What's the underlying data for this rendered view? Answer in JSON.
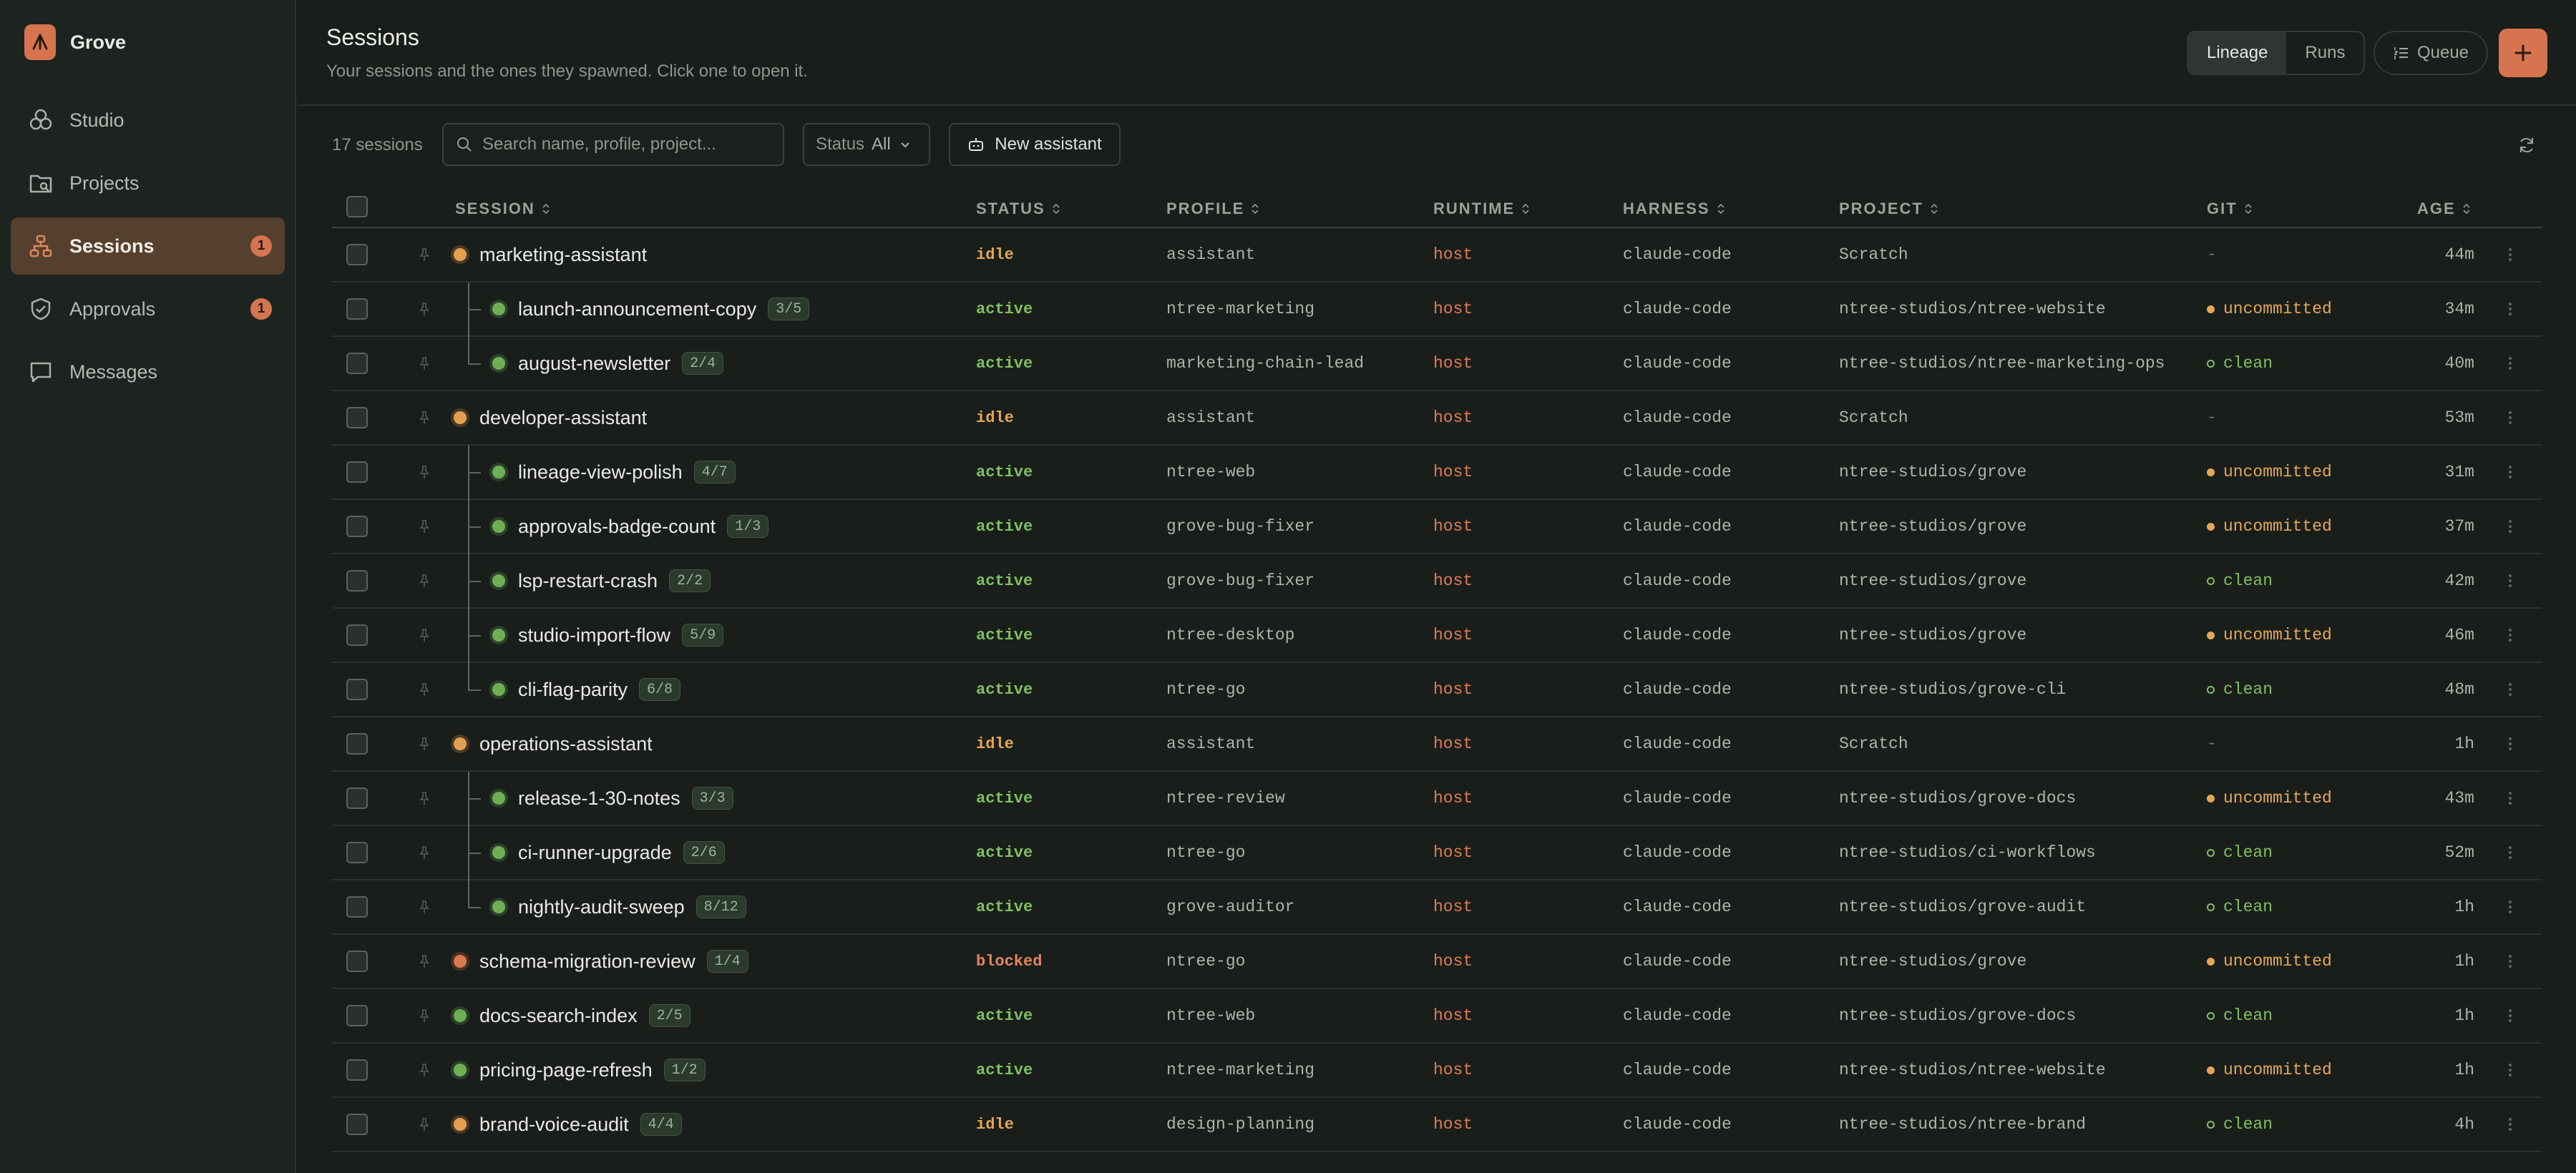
{
  "app": {
    "name": "Grove",
    "accent": "#d5744e"
  },
  "sidebar": {
    "items": [
      {
        "label": "Studio",
        "icon": "studio-icon",
        "badge": null,
        "active": false
      },
      {
        "label": "Projects",
        "icon": "projects-icon",
        "badge": null,
        "active": false
      },
      {
        "label": "Sessions",
        "icon": "sessions-icon",
        "badge": "1",
        "active": true
      },
      {
        "label": "Approvals",
        "icon": "approvals-icon",
        "badge": "1",
        "active": false
      },
      {
        "label": "Messages",
        "icon": "messages-icon",
        "badge": null,
        "active": false
      }
    ]
  },
  "header": {
    "title": "Sessions",
    "subtitle": "Your sessions and the ones they spawned. Click one to open it.",
    "view_tabs": [
      "Lineage",
      "Runs"
    ],
    "active_view": "Lineage",
    "queue_label": "Queue",
    "add_icon": "plus-icon"
  },
  "toolbar": {
    "count_label": "17 sessions",
    "search_placeholder": "Search name, profile, project...",
    "status_label": "Status",
    "status_value": "All",
    "new_assistant_label": "New assistant",
    "refresh_icon": "refresh-icon"
  },
  "table": {
    "columns": [
      "SESSION",
      "STATUS",
      "PROFILE",
      "RUNTIME",
      "HARNESS",
      "PROJECT",
      "GIT",
      "AGE"
    ],
    "rows": [
      {
        "name": "marketing-assistant",
        "progress": "",
        "level": 0,
        "tree": "",
        "dot": "orange",
        "status": "idle",
        "profile": "assistant",
        "runtime": "host",
        "harness": "claude-code",
        "project": "Scratch",
        "git": "-",
        "git_state": "none",
        "age": "44m"
      },
      {
        "name": "launch-announcement-copy",
        "progress": "3/5",
        "level": 1,
        "tree": "mid",
        "dot": "green",
        "status": "active",
        "profile": "ntree-marketing",
        "runtime": "host",
        "harness": "claude-code",
        "project": "ntree-studios/ntree-website",
        "git": "uncommitted",
        "git_state": "uncommitted",
        "age": "34m"
      },
      {
        "name": "august-newsletter",
        "progress": "2/4",
        "level": 1,
        "tree": "last",
        "dot": "green",
        "status": "active",
        "profile": "marketing-chain-lead",
        "runtime": "host",
        "harness": "claude-code",
        "project": "ntree-studios/ntree-marketing-ops",
        "git": "clean",
        "git_state": "clean",
        "age": "40m"
      },
      {
        "name": "developer-assistant",
        "progress": "",
        "level": 0,
        "tree": "",
        "dot": "orange",
        "status": "idle",
        "profile": "assistant",
        "runtime": "host",
        "harness": "claude-code",
        "project": "Scratch",
        "git": "-",
        "git_state": "none",
        "age": "53m"
      },
      {
        "name": "lineage-view-polish",
        "progress": "4/7",
        "level": 1,
        "tree": "mid",
        "dot": "green",
        "status": "active",
        "profile": "ntree-web",
        "runtime": "host",
        "harness": "claude-code",
        "project": "ntree-studios/grove",
        "git": "uncommitted",
        "git_state": "uncommitted",
        "age": "31m"
      },
      {
        "name": "approvals-badge-count",
        "progress": "1/3",
        "level": 1,
        "tree": "mid",
        "dot": "green",
        "status": "active",
        "profile": "grove-bug-fixer",
        "runtime": "host",
        "harness": "claude-code",
        "project": "ntree-studios/grove",
        "git": "uncommitted",
        "git_state": "uncommitted",
        "age": "37m"
      },
      {
        "name": "lsp-restart-crash",
        "progress": "2/2",
        "level": 1,
        "tree": "mid",
        "dot": "green",
        "status": "active",
        "profile": "grove-bug-fixer",
        "runtime": "host",
        "harness": "claude-code",
        "project": "ntree-studios/grove",
        "git": "clean",
        "git_state": "clean",
        "age": "42m"
      },
      {
        "name": "studio-import-flow",
        "progress": "5/9",
        "level": 1,
        "tree": "mid",
        "dot": "green",
        "status": "active",
        "profile": "ntree-desktop",
        "runtime": "host",
        "harness": "claude-code",
        "project": "ntree-studios/grove",
        "git": "uncommitted",
        "git_state": "uncommitted",
        "age": "46m"
      },
      {
        "name": "cli-flag-parity",
        "progress": "6/8",
        "level": 1,
        "tree": "last",
        "dot": "green",
        "status": "active",
        "profile": "ntree-go",
        "runtime": "host",
        "harness": "claude-code",
        "project": "ntree-studios/grove-cli",
        "git": "clean",
        "git_state": "clean",
        "age": "48m"
      },
      {
        "name": "operations-assistant",
        "progress": "",
        "level": 0,
        "tree": "",
        "dot": "orange",
        "status": "idle",
        "profile": "assistant",
        "runtime": "host",
        "harness": "claude-code",
        "project": "Scratch",
        "git": "-",
        "git_state": "none",
        "age": "1h"
      },
      {
        "name": "release-1-30-notes",
        "progress": "3/3",
        "level": 1,
        "tree": "mid",
        "dot": "green",
        "status": "active",
        "profile": "ntree-review",
        "runtime": "host",
        "harness": "claude-code",
        "project": "ntree-studios/grove-docs",
        "git": "uncommitted",
        "git_state": "uncommitted",
        "age": "43m"
      },
      {
        "name": "ci-runner-upgrade",
        "progress": "2/6",
        "level": 1,
        "tree": "mid",
        "dot": "green",
        "status": "active",
        "profile": "ntree-go",
        "runtime": "host",
        "harness": "claude-code",
        "project": "ntree-studios/ci-workflows",
        "git": "clean",
        "git_state": "clean",
        "age": "52m"
      },
      {
        "name": "nightly-audit-sweep",
        "progress": "8/12",
        "level": 1,
        "tree": "last",
        "dot": "green",
        "status": "active",
        "profile": "grove-auditor",
        "runtime": "host",
        "harness": "claude-code",
        "project": "ntree-studios/grove-audit",
        "git": "clean",
        "git_state": "clean",
        "age": "1h"
      },
      {
        "name": "schema-migration-review",
        "progress": "1/4",
        "level": 0,
        "tree": "",
        "dot": "red",
        "status": "blocked",
        "profile": "ntree-go",
        "runtime": "host",
        "harness": "claude-code",
        "project": "ntree-studios/grove",
        "git": "uncommitted",
        "git_state": "uncommitted",
        "age": "1h"
      },
      {
        "name": "docs-search-index",
        "progress": "2/5",
        "level": 0,
        "tree": "",
        "dot": "green",
        "status": "active",
        "profile": "ntree-web",
        "runtime": "host",
        "harness": "claude-code",
        "project": "ntree-studios/grove-docs",
        "git": "clean",
        "git_state": "clean",
        "age": "1h"
      },
      {
        "name": "pricing-page-refresh",
        "progress": "1/2",
        "level": 0,
        "tree": "",
        "dot": "green",
        "status": "active",
        "profile": "ntree-marketing",
        "runtime": "host",
        "harness": "claude-code",
        "project": "ntree-studios/ntree-website",
        "git": "uncommitted",
        "git_state": "uncommitted",
        "age": "1h"
      },
      {
        "name": "brand-voice-audit",
        "progress": "4/4",
        "level": 0,
        "tree": "",
        "dot": "orange",
        "status": "idle",
        "profile": "design-planning",
        "runtime": "host",
        "harness": "claude-code",
        "project": "ntree-studios/ntree-brand",
        "git": "clean",
        "git_state": "clean",
        "age": "4h"
      }
    ]
  }
}
